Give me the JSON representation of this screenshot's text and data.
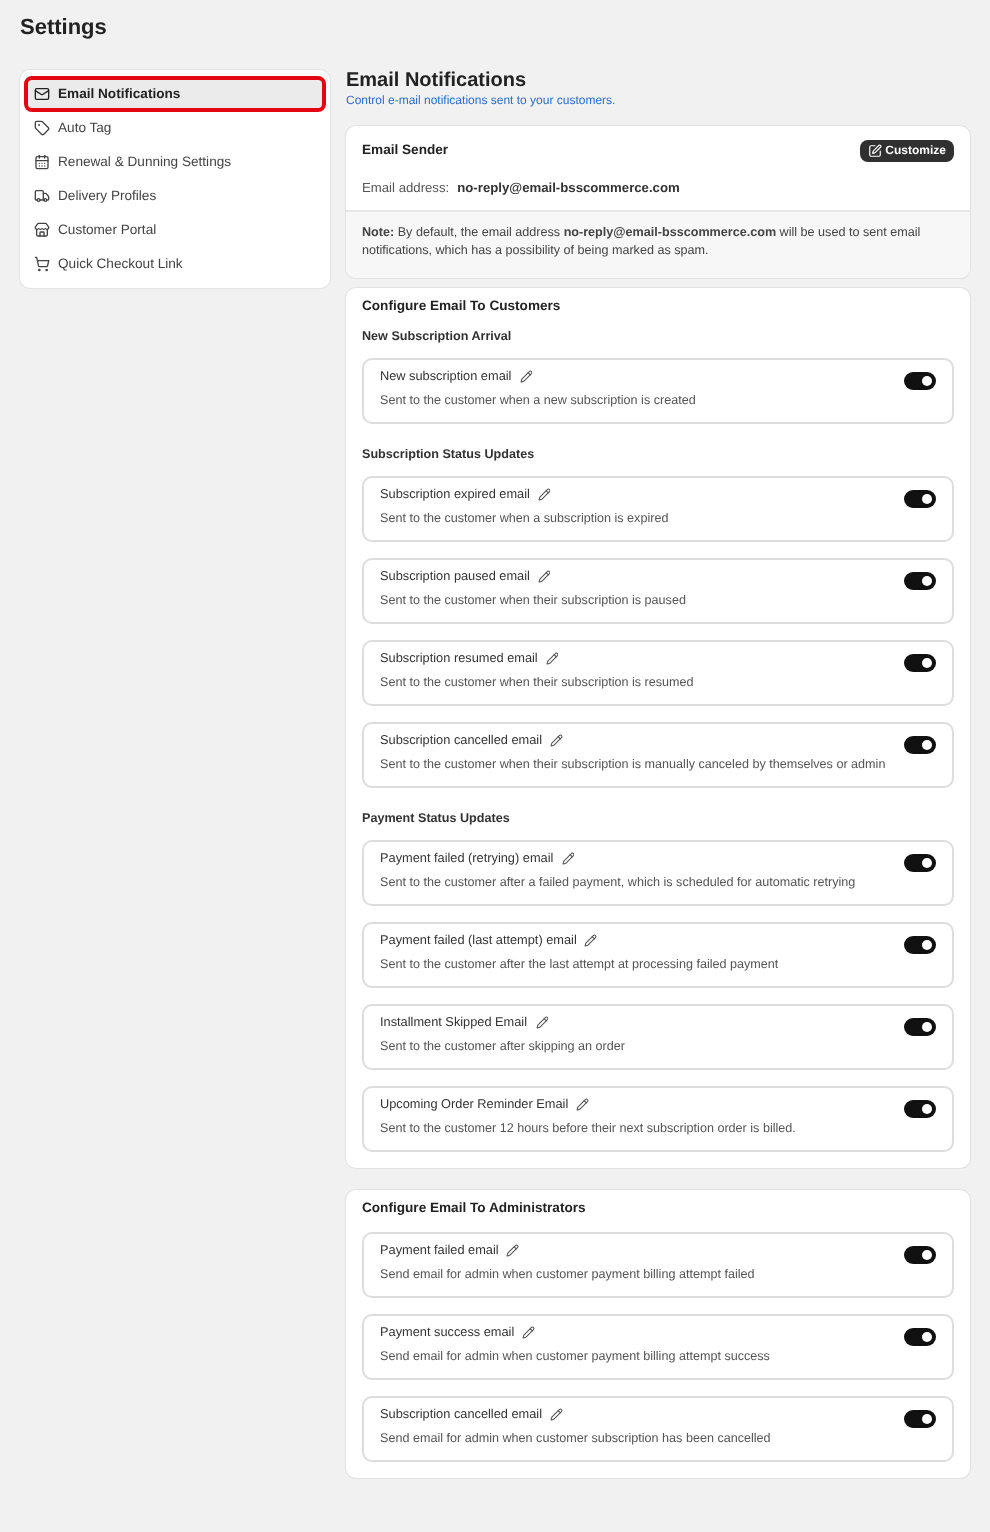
{
  "page_title": "Settings",
  "sidebar": {
    "items": [
      {
        "label": "Email Notifications",
        "selected": true
      },
      {
        "label": "Auto Tag",
        "selected": false
      },
      {
        "label": "Renewal & Dunning Settings",
        "selected": false
      },
      {
        "label": "Delivery Profiles",
        "selected": false
      },
      {
        "label": "Customer Portal",
        "selected": false
      },
      {
        "label": "Quick Checkout Link",
        "selected": false
      }
    ]
  },
  "header": {
    "title": "Email Notifications",
    "subtitle": "Control e-mail notifications sent to your customers."
  },
  "sender": {
    "title": "Email Sender",
    "button": "Customize",
    "address_label": "Email address:",
    "address": "no-reply@email-bsscommerce.com",
    "note": "**Note:** By default, the email address **no-reply@email-bsscommerce.com** will be used to sent email notifications, which has a possibility of being marked as spam."
  },
  "sections": [
    {
      "title": "Configure Email To Customers",
      "groups": [
        {
          "title": "New Subscription Arrival",
          "items": [
            {
              "name": "New subscription email",
              "description": "Sent to the customer when a new subscription is created",
              "on": true
            }
          ]
        },
        {
          "title": "Subscription Status Updates",
          "items": [
            {
              "name": "Subscription expired email",
              "description": "Sent to the customer when a subscription is expired",
              "on": true
            },
            {
              "name": "Subscription paused email",
              "description": "Sent to the customer when their subscription is paused",
              "on": true
            },
            {
              "name": "Subscription resumed email",
              "description": "Sent to the customer when their subscription is resumed",
              "on": true
            },
            {
              "name": "Subscription cancelled email",
              "description": "Sent to the customer when their subscription is manually canceled by themselves or admin",
              "on": true
            }
          ]
        },
        {
          "title": "Payment Status Updates",
          "items": [
            {
              "name": "Payment failed (retrying) email",
              "description": "Sent to the customer after a failed payment, which is scheduled for automatic retrying",
              "on": true
            },
            {
              "name": "Payment failed (last attempt) email",
              "description": "Sent to the customer after the last attempt at processing failed payment",
              "on": true
            },
            {
              "name": "Installment Skipped Email",
              "description": "Sent to the customer after skipping an order",
              "on": true
            },
            {
              "name": "Upcoming Order Reminder Email",
              "description": "Sent to the customer 12 hours before their next subscription order is billed.",
              "on": true
            }
          ]
        }
      ]
    },
    {
      "title": "Configure Email To Administrators",
      "groups": [
        {
          "items": [
            {
              "name": "Payment failed email",
              "description": "Send email for admin when customer payment billing attempt failed",
              "on": true
            },
            {
              "name": "Payment success email",
              "description": "Send email for admin when customer payment billing attempt success",
              "on": true
            },
            {
              "name": "Subscription cancelled email",
              "description": "Send email for admin when customer subscription has been cancelled",
              "on": true
            }
          ]
        }
      ]
    }
  ]
}
